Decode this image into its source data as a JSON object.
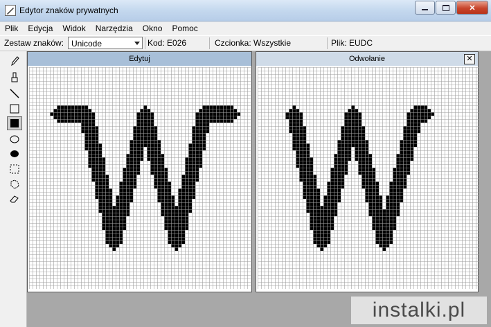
{
  "window": {
    "title": "Edytor znaków prywatnych",
    "minimize_icon": "minimize-icon",
    "maximize_icon": "maximize-icon",
    "close_icon": "close-icon",
    "close_glyph": "✕"
  },
  "menu": [
    "Plik",
    "Edycja",
    "Widok",
    "Narzędzia",
    "Okno",
    "Pomoc"
  ],
  "toolbar": {
    "charset_label": "Zestaw znaków:",
    "charset_value": "Unicode",
    "code": "Kod: E026",
    "font": "Czcionka: Wszystkie",
    "file": "Plik: EUDC"
  },
  "tools": [
    "pencil-icon",
    "brush-icon",
    "line-icon",
    "hollow-rectangle-icon",
    "filled-rectangle-icon",
    "hollow-ellipse-icon",
    "filled-ellipse-icon",
    "rectangular-selection-icon",
    "freeform-selection-icon",
    "eraser-icon"
  ],
  "selected_tool": "filled-rectangle-icon",
  "panels": {
    "edit": {
      "title": "Edytuj",
      "header_color": "#a8bfd8"
    },
    "reference": {
      "title": "Odwołanie",
      "header_color": "#cfdbe8",
      "close_glyph": "✕"
    }
  },
  "watermark": "instalki.pl",
  "colors": {
    "grid_line": "#a0a0a0",
    "glyph": "#000000",
    "workspace": "#a8a8a8"
  }
}
